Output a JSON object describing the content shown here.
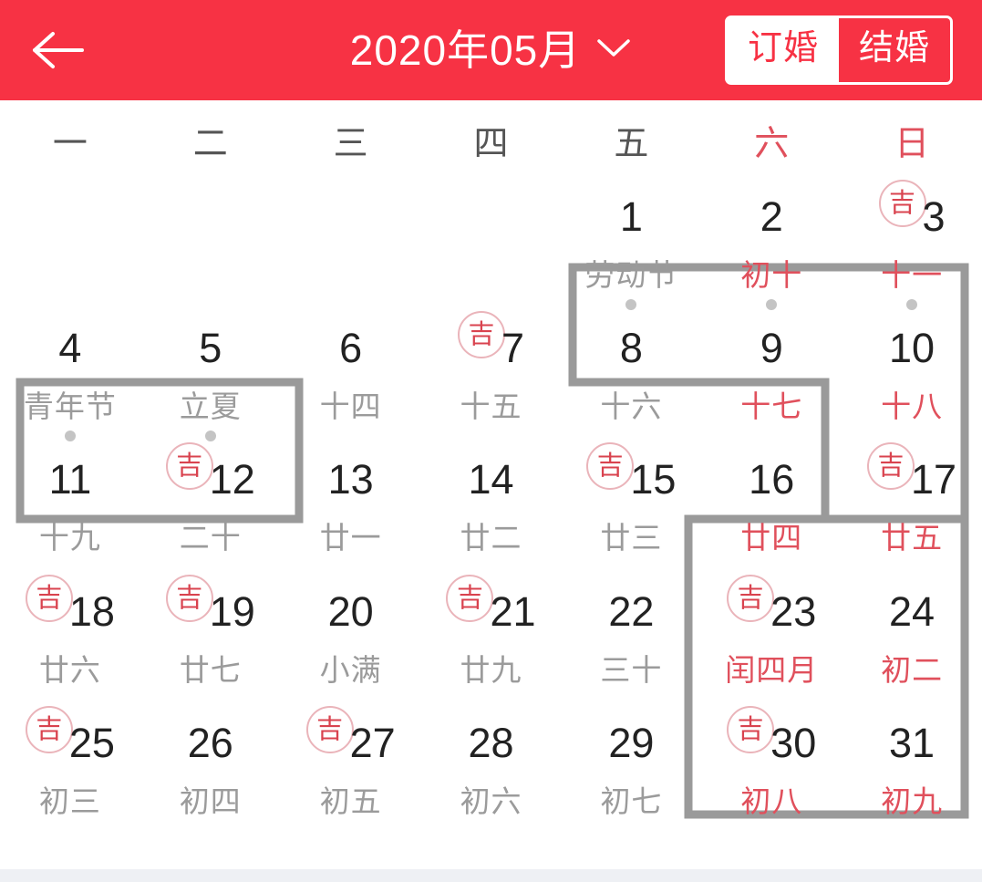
{
  "header": {
    "back_icon": "back-arrow-icon",
    "title": "2020年05月",
    "dropdown_icon": "chevron-down-icon",
    "toggle": {
      "inactive_label": "订婚",
      "active_label": "结婚",
      "active_index": 1
    },
    "bg_color": "#f73244",
    "text_color": "#ffffff"
  },
  "weekdays": [
    {
      "label": "一",
      "weekend": false
    },
    {
      "label": "二",
      "weekend": false
    },
    {
      "label": "三",
      "weekend": false
    },
    {
      "label": "四",
      "weekend": false
    },
    {
      "label": "五",
      "weekend": false
    },
    {
      "label": "六",
      "weekend": true
    },
    {
      "label": "日",
      "weekend": true
    }
  ],
  "colors": {
    "accent_red": "#f73244",
    "weekend_red": "#e0505c",
    "day_text": "#222222",
    "sub_gray": "#9b9b9b",
    "outline_gray": "#9a9a9a",
    "badge_ring": "#eab4ba",
    "badge_text": "#d9434f",
    "dot_gray": "#c4c4c4"
  },
  "badge": {
    "label": "吉",
    "name": "auspicious-badge"
  },
  "cells": [
    {
      "empty": true
    },
    {
      "empty": true
    },
    {
      "empty": true
    },
    {
      "empty": true
    },
    {
      "day": "1",
      "sub": "劳动节",
      "sub_red": false,
      "badge": false,
      "dot": true
    },
    {
      "day": "2",
      "sub": "初十",
      "sub_red": true,
      "badge": false,
      "dot": true
    },
    {
      "day": "3",
      "sub": "十一",
      "sub_red": true,
      "badge": true,
      "dot": true
    },
    {
      "day": "4",
      "sub": "青年节",
      "sub_red": false,
      "badge": false,
      "dot": true
    },
    {
      "day": "5",
      "sub": "立夏",
      "sub_red": false,
      "badge": false,
      "dot": true
    },
    {
      "day": "6",
      "sub": "十四",
      "sub_red": false,
      "badge": false,
      "dot": false
    },
    {
      "day": "7",
      "sub": "十五",
      "sub_red": false,
      "badge": true,
      "dot": false
    },
    {
      "day": "8",
      "sub": "十六",
      "sub_red": false,
      "badge": false,
      "dot": false
    },
    {
      "day": "9",
      "sub": "十七",
      "sub_red": true,
      "badge": false,
      "dot": false
    },
    {
      "day": "10",
      "sub": "十八",
      "sub_red": true,
      "badge": false,
      "dot": false
    },
    {
      "day": "11",
      "sub": "十九",
      "sub_red": false,
      "badge": false,
      "dot": false
    },
    {
      "day": "12",
      "sub": "二十",
      "sub_red": false,
      "badge": true,
      "dot": false
    },
    {
      "day": "13",
      "sub": "廿一",
      "sub_red": false,
      "badge": false,
      "dot": false
    },
    {
      "day": "14",
      "sub": "廿二",
      "sub_red": false,
      "badge": false,
      "dot": false
    },
    {
      "day": "15",
      "sub": "廿三",
      "sub_red": false,
      "badge": true,
      "dot": false
    },
    {
      "day": "16",
      "sub": "廿四",
      "sub_red": true,
      "badge": false,
      "dot": false
    },
    {
      "day": "17",
      "sub": "廿五",
      "sub_red": true,
      "badge": true,
      "dot": false
    },
    {
      "day": "18",
      "sub": "廿六",
      "sub_red": false,
      "badge": true,
      "dot": false
    },
    {
      "day": "19",
      "sub": "廿七",
      "sub_red": false,
      "badge": true,
      "dot": false
    },
    {
      "day": "20",
      "sub": "小满",
      "sub_red": false,
      "badge": false,
      "dot": false
    },
    {
      "day": "21",
      "sub": "廿九",
      "sub_red": false,
      "badge": true,
      "dot": false
    },
    {
      "day": "22",
      "sub": "三十",
      "sub_red": false,
      "badge": false,
      "dot": false
    },
    {
      "day": "23",
      "sub": "闰四月",
      "sub_red": true,
      "badge": true,
      "dot": false
    },
    {
      "day": "24",
      "sub": "初二",
      "sub_red": true,
      "badge": false,
      "dot": false
    },
    {
      "day": "25",
      "sub": "初三",
      "sub_red": false,
      "badge": true,
      "dot": false
    },
    {
      "day": "26",
      "sub": "初四",
      "sub_red": false,
      "badge": false,
      "dot": false
    },
    {
      "day": "27",
      "sub": "初五",
      "sub_red": false,
      "badge": true,
      "dot": false
    },
    {
      "day": "28",
      "sub": "初六",
      "sub_red": false,
      "badge": false,
      "dot": false
    },
    {
      "day": "29",
      "sub": "初七",
      "sub_red": false,
      "badge": false,
      "dot": false
    },
    {
      "day": "30",
      "sub": "初八",
      "sub_red": true,
      "badge": true,
      "dot": false
    },
    {
      "day": "31",
      "sub": "初九",
      "sub_red": true,
      "badge": false,
      "dot": false
    }
  ],
  "highlight_regions": [
    {
      "name": "holiday-outline-may-4-5",
      "description": "rectangle around 4 and 5"
    },
    {
      "name": "holiday-outline-may-1-3",
      "description": "rectangle around 1 2 3"
    },
    {
      "name": "weekend-outline-may-8-31",
      "description": "stepped outline from 8/9 down through 16,17,23,24,30,31"
    }
  ]
}
